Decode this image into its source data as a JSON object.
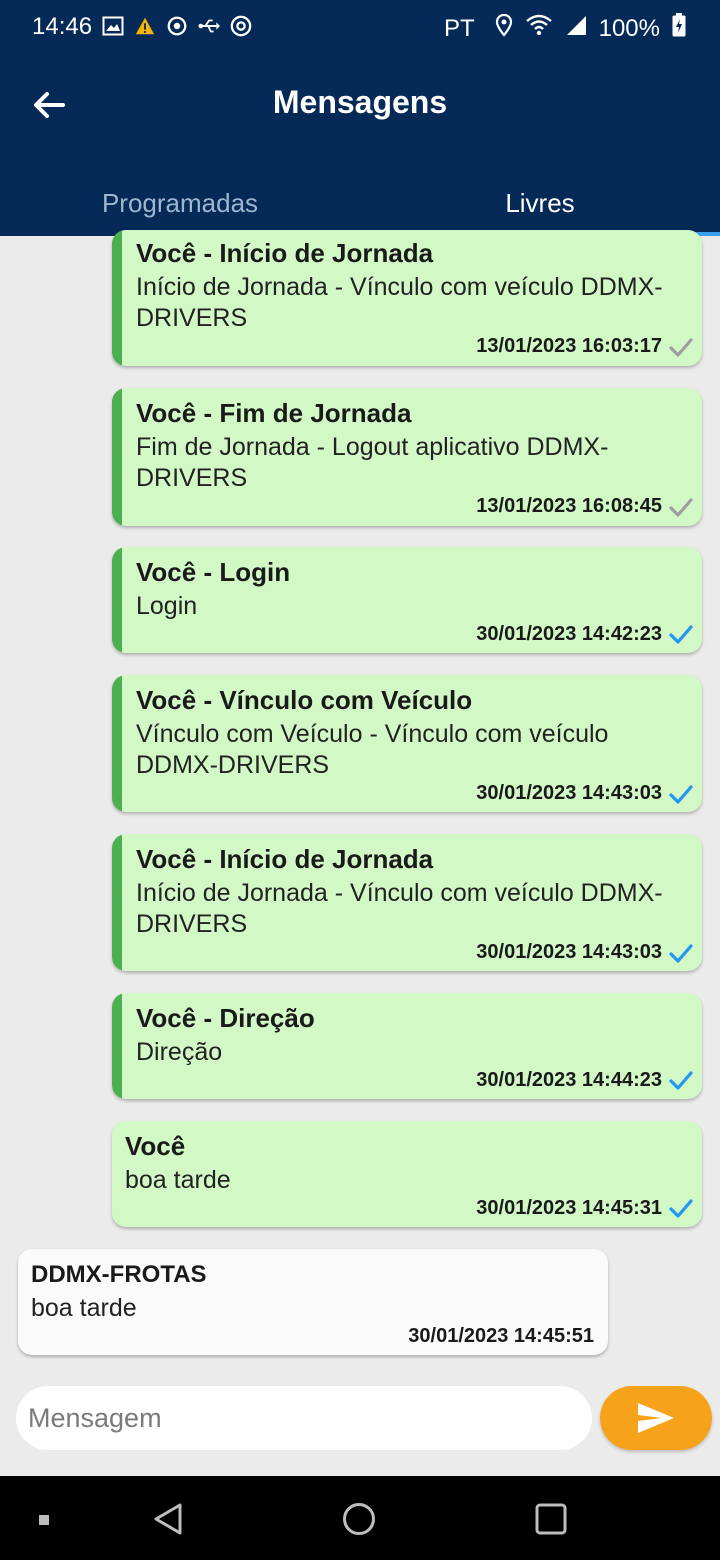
{
  "status_bar": {
    "time": "14:46",
    "language": "PT",
    "battery": "100%",
    "icons_left": [
      "image-icon",
      "warning-icon",
      "sync-icon",
      "usb-icon",
      "sos-icon"
    ],
    "icons_right": [
      "location-icon",
      "wifi-icon",
      "signal-icon",
      "battery-icon"
    ]
  },
  "header": {
    "title": "Mensagens",
    "back_icon": "arrow-left-icon"
  },
  "tabs": [
    {
      "label": "Programadas",
      "active": false
    },
    {
      "label": "Livres",
      "active": true
    }
  ],
  "messages": [
    {
      "sender": "Você - Início de Jornada",
      "body": "Início de Jornada - Vínculo com veículo DDMX-DRIVERS",
      "timestamp": "13/01/2023 16:03:17",
      "status": "delivered-grey"
    },
    {
      "sender": "Você - Fim de Jornada",
      "body": "Fim de Jornada - Logout aplicativo DDMX-DRIVERS",
      "timestamp": "13/01/2023 16:08:45",
      "status": "delivered-grey"
    },
    {
      "sender": "Você - Login",
      "body": "Login",
      "timestamp": "30/01/2023 14:42:23",
      "status": "read-blue"
    },
    {
      "sender": "Você - Vínculo com Veículo",
      "body": "Vínculo com Veículo - Vínculo com veículo DDMX-DRIVERS",
      "timestamp": "30/01/2023 14:43:03",
      "status": "read-blue"
    },
    {
      "sender": "Você - Início de Jornada",
      "body": "Início de Jornada - Vínculo com veículo DDMX-DRIVERS",
      "timestamp": "30/01/2023 14:43:03",
      "status": "read-blue"
    },
    {
      "sender": "Você - Direção",
      "body": "Direção",
      "timestamp": "30/01/2023 14:44:23",
      "status": "read-blue"
    },
    {
      "sender": "Você",
      "body": "boa tarde",
      "timestamp": "30/01/2023 14:45:31",
      "status": "read-blue"
    }
  ],
  "incoming": [
    {
      "sender": "DDMX-FROTAS",
      "body": "boa tarde",
      "timestamp": "30/01/2023 14:45:51"
    }
  ],
  "composer": {
    "placeholder": "Mensagem",
    "send_icon": "send-icon"
  },
  "colors": {
    "app_bar": "#052a57",
    "outgoing_bubble": "#d2f8c6",
    "event_border": "#4caf50",
    "read_check": "#2196f3",
    "delivered_check": "#9e9e9e",
    "send_button": "#f7a21b",
    "tab_indicator": "#3aa0f2"
  }
}
